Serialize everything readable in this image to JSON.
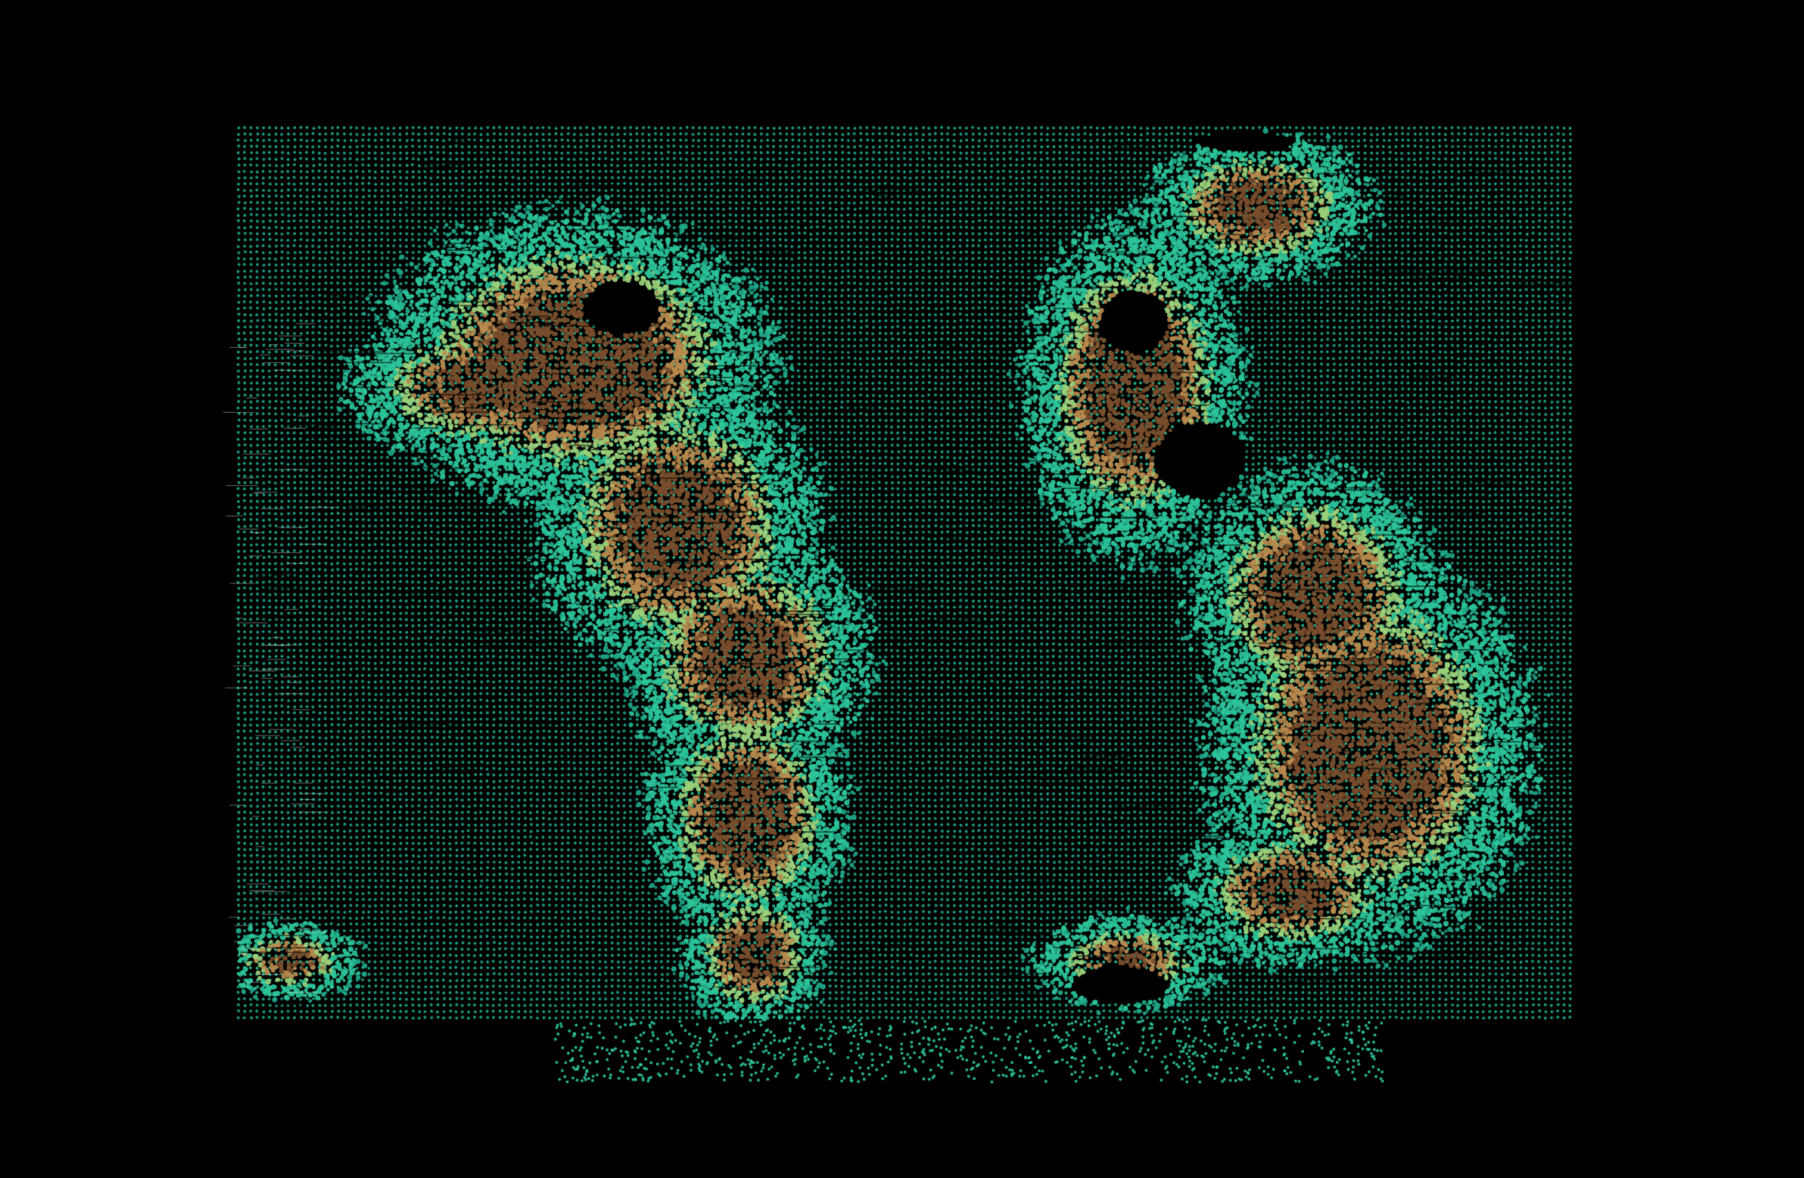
{
  "scene": {
    "subject": "point-cloud-terrain-map",
    "background_color": "#000000",
    "palette": {
      "ocean_teal": "#1fa888",
      "shore_teal": "#2cc49a",
      "lowland_lime": "#9bd07a",
      "highland_tan": "#b98a4e",
      "peak_brown": "#7a4e2c"
    }
  }
}
